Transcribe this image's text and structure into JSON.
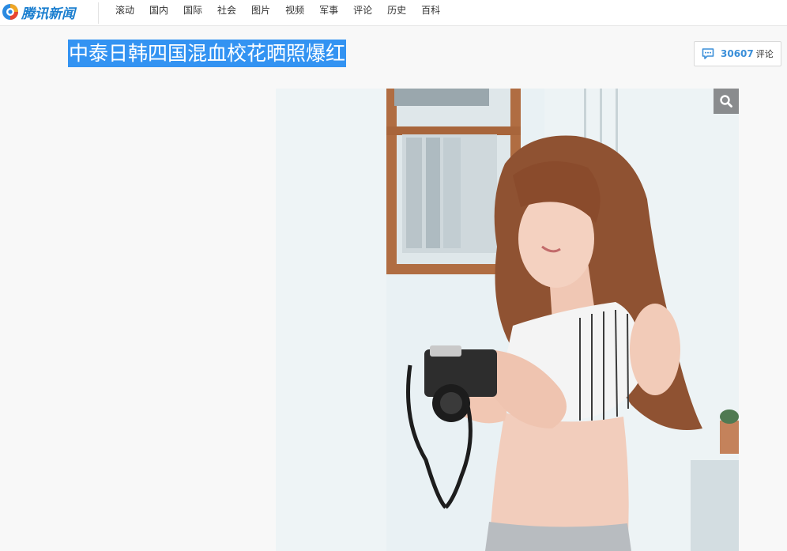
{
  "header": {
    "logo_text": "腾讯新闻",
    "nav": [
      "滚动",
      "国内",
      "国际",
      "社会",
      "图片",
      "视频",
      "军事",
      "评论",
      "历史",
      "百科"
    ]
  },
  "article": {
    "title": "中泰日韩四国混血校花晒照爆红",
    "comment_count": "30607",
    "comment_label": "评论"
  },
  "photo": {
    "subject": "young woman holding a camera"
  },
  "icons": {
    "logo": "tencent-news-logo-icon",
    "comment": "comment-bubble-icon",
    "zoom": "magnifier-icon"
  },
  "colors": {
    "accent": "#3393f2",
    "brand": "#1a7ecf",
    "comment_count": "#3b8fd9"
  }
}
